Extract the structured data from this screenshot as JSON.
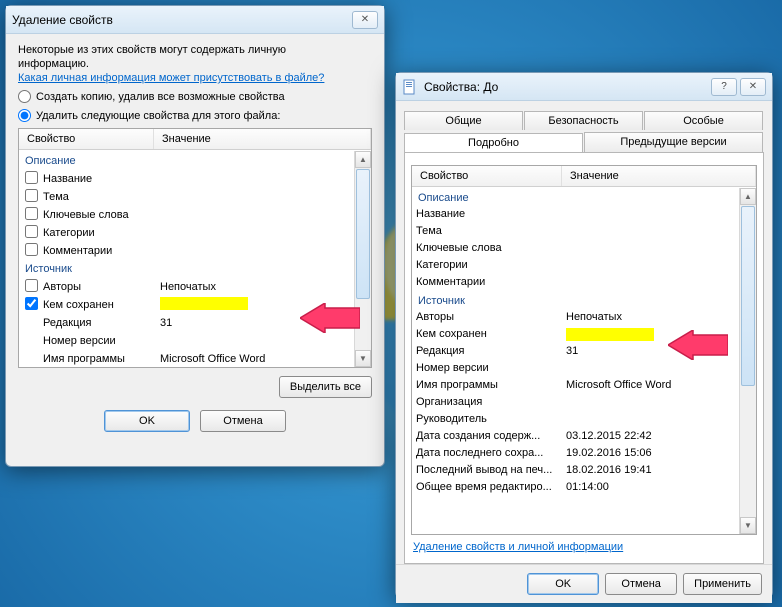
{
  "win1": {
    "title": "Удаление свойств",
    "info1": "Некоторые из этих свойств могут содержать личную",
    "info2": "информацию.",
    "link": "Какая личная информация может присутствовать в файле?",
    "radio1": "Создать копию, удалив все возможные свойства",
    "radio2": "Удалить следующие свойства для этого файла:",
    "col_prop": "Свойство",
    "col_val": "Значение",
    "grp_desc": "Описание",
    "grp_src": "Источник",
    "rows_desc": [
      {
        "name": "Название",
        "val": ""
      },
      {
        "name": "Тема",
        "val": ""
      },
      {
        "name": "Ключевые слова",
        "val": ""
      },
      {
        "name": "Категории",
        "val": ""
      },
      {
        "name": "Комментарии",
        "val": ""
      }
    ],
    "rows_src": [
      {
        "name": "Авторы",
        "val": "Непочатых",
        "cb": false
      },
      {
        "name": "Кем сохранен",
        "val": "__YELLOW__",
        "cb": true
      },
      {
        "name": "Редакция",
        "val": "31",
        "cb": false,
        "nocb": true
      },
      {
        "name": "Номер версии",
        "val": "",
        "cb": false,
        "nocb": true
      },
      {
        "name": "Имя программы",
        "val": "Microsoft Office Word",
        "cb": false,
        "nocb": true
      }
    ],
    "select_all": "Выделить все",
    "ok": "OK",
    "cancel": "Отмена"
  },
  "win2": {
    "title": "Свойства: До",
    "tabs_row1": [
      "Общие",
      "Безопасность",
      "Особые"
    ],
    "tabs_row2": [
      "Подробно",
      "Предыдущие версии"
    ],
    "active_tab": "Подробно",
    "col_prop": "Свойство",
    "col_val": "Значение",
    "grp_desc": "Описание",
    "grp_src": "Источник",
    "rows_desc": [
      {
        "name": "Название",
        "val": ""
      },
      {
        "name": "Тема",
        "val": ""
      },
      {
        "name": "Ключевые слова",
        "val": ""
      },
      {
        "name": "Категории",
        "val": ""
      },
      {
        "name": "Комментарии",
        "val": ""
      }
    ],
    "rows_src": [
      {
        "name": "Авторы",
        "val": "Непочатых"
      },
      {
        "name": "Кем сохранен",
        "val": "__YELLOW__"
      },
      {
        "name": "Редакция",
        "val": "31"
      },
      {
        "name": "Номер версии",
        "val": ""
      },
      {
        "name": "Имя программы",
        "val": "Microsoft Office Word"
      },
      {
        "name": "Организация",
        "val": ""
      },
      {
        "name": "Руководитель",
        "val": ""
      },
      {
        "name": "Дата создания содерж...",
        "val": "03.12.2015 22:42"
      },
      {
        "name": "Дата последнего сохра...",
        "val": "19.02.2016 15:06"
      },
      {
        "name": "Последний вывод на печ...",
        "val": "18.02.2016 19:41"
      },
      {
        "name": "Общее время редактиро...",
        "val": "01:14:00"
      }
    ],
    "link": "Удаление свойств и личной информации",
    "ok": "OK",
    "cancel": "Отмена",
    "apply": "Применить"
  }
}
